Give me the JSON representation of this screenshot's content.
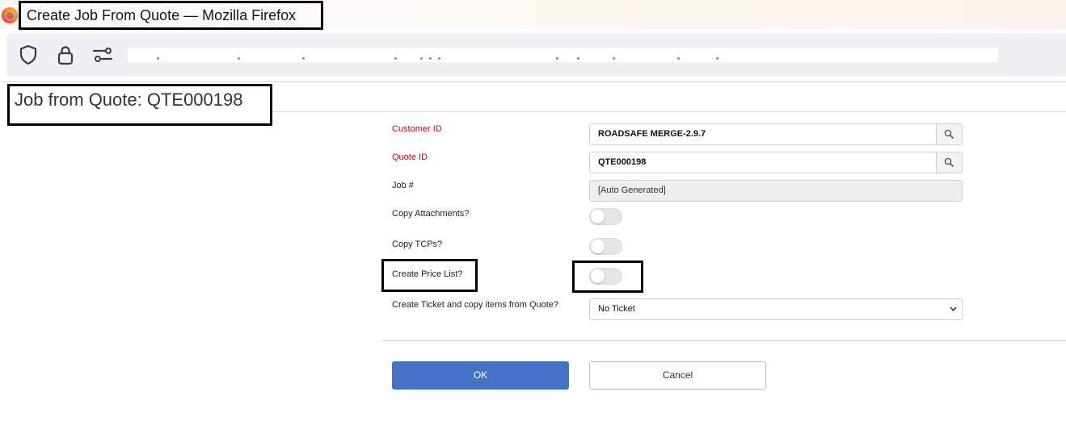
{
  "window": {
    "title": "Create Job From Quote — Mozilla Firefox"
  },
  "toolbar": {
    "icons": [
      "shield-icon",
      "lock-icon",
      "permissions-icon"
    ]
  },
  "page": {
    "title": "Job from Quote: QTE000198"
  },
  "form": {
    "customer_id": {
      "label": "Customer ID",
      "value": "ROADSAFE MERGE-2.9.7"
    },
    "quote_id": {
      "label": "Quote ID",
      "value": "QTE000198"
    },
    "job_number": {
      "label": "Job #",
      "value": "[Auto Generated]"
    },
    "copy_attachments": {
      "label": "Copy Attachments?",
      "on": false
    },
    "copy_tcps": {
      "label": "Copy TCPs?",
      "on": false
    },
    "create_price_list": {
      "label": "Create Price List?",
      "on": false
    },
    "create_ticket": {
      "label": "Create Ticket and copy items from Quote?",
      "selected": "No Ticket"
    }
  },
  "buttons": {
    "ok": "OK",
    "cancel": "Cancel"
  },
  "colors": {
    "required_label": "#d0021b",
    "primary_button": "#4472c4"
  }
}
